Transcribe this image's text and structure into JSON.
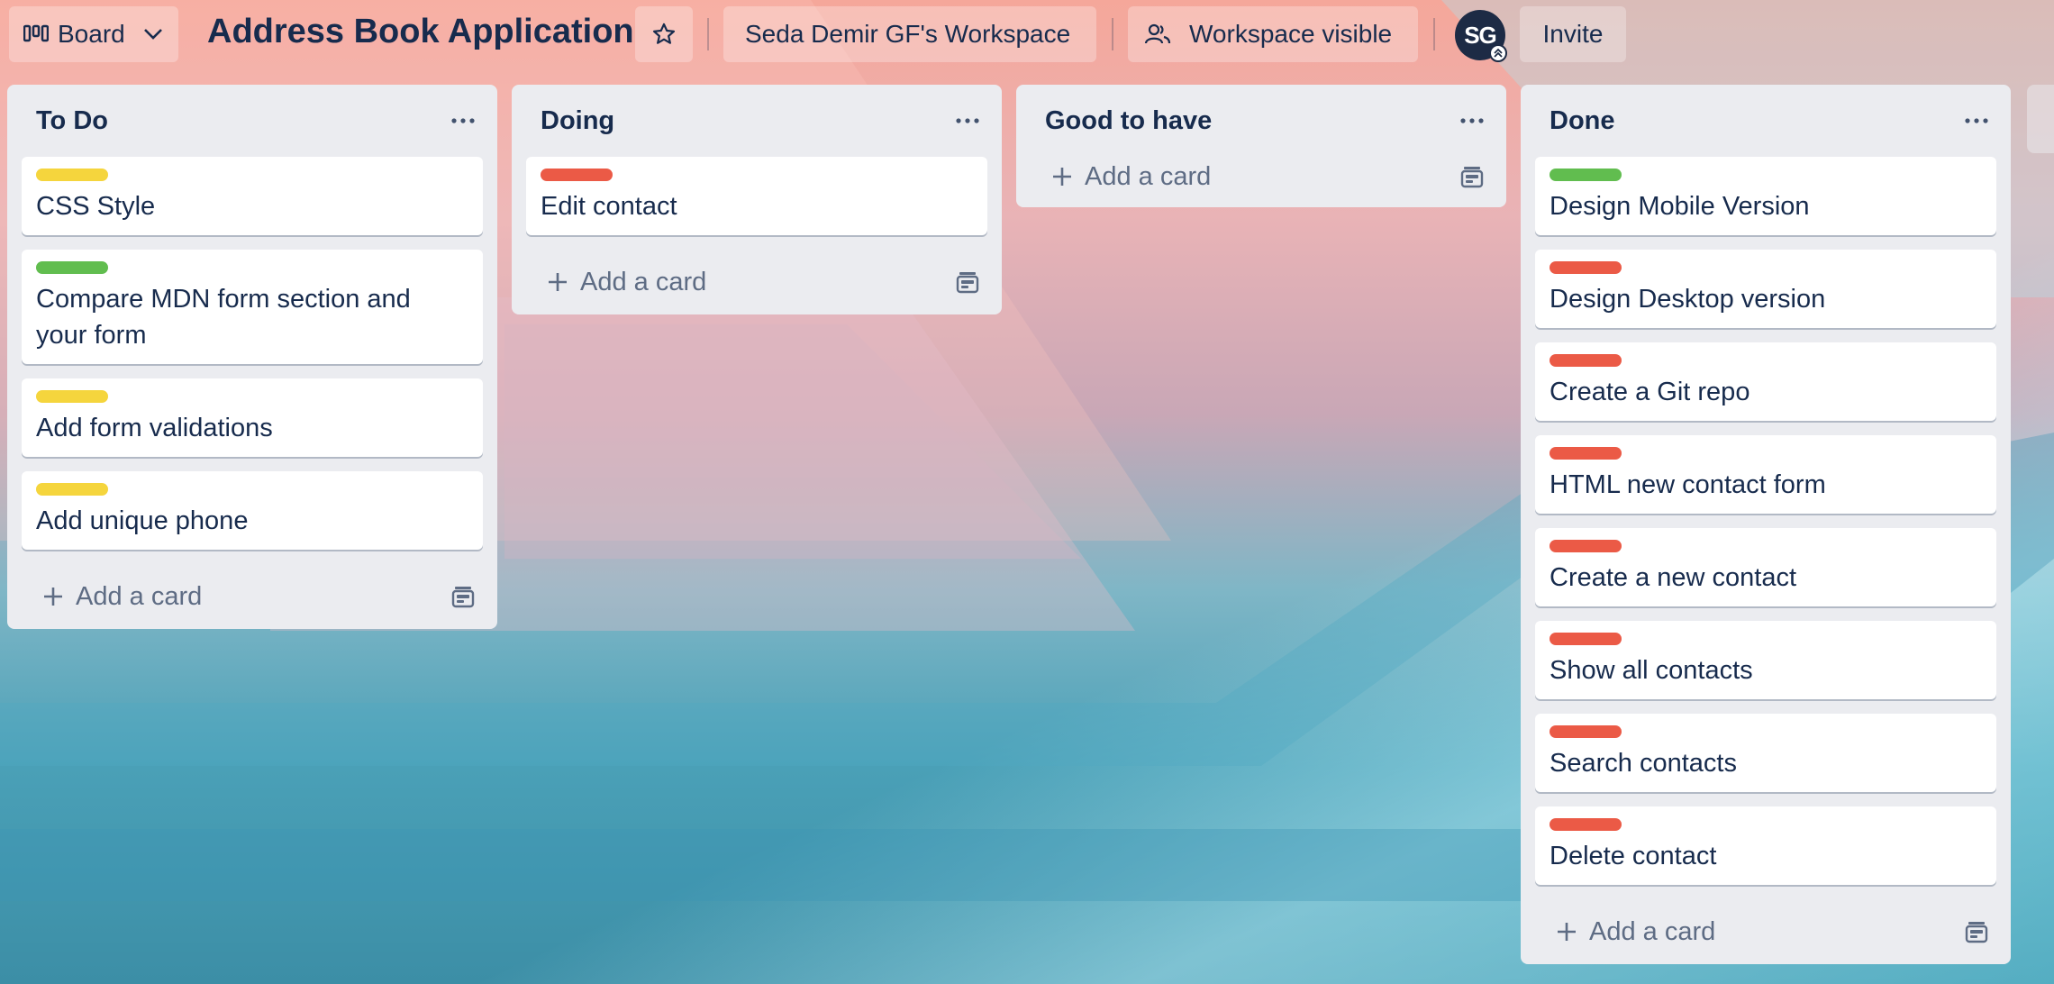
{
  "header": {
    "view_button": {
      "label": "Board",
      "icon": "board-icon"
    },
    "board_title": "Address Book Application",
    "star_icon": "star-icon",
    "workspace_button": {
      "label": "Seda Demir GF's Workspace"
    },
    "visibility_button": {
      "label": "Workspace visible",
      "icon": "people-icon"
    },
    "avatar": {
      "initials": "SG"
    },
    "invite_button": {
      "label": "Invite"
    }
  },
  "colors": {
    "yellow": "#f5d53d",
    "green": "#61bd4f",
    "red": "#eb5a46",
    "list_bg": "#ebecf0",
    "text": "#172b4d"
  },
  "lists": [
    {
      "title": "To Do",
      "cards": [
        {
          "label_color": "yellow",
          "title": "CSS Style"
        },
        {
          "label_color": "green",
          "title": "Compare MDN form section and your form"
        },
        {
          "label_color": "yellow",
          "title": "Add form validations"
        },
        {
          "label_color": "yellow",
          "title": "Add unique phone"
        }
      ],
      "add_label": "Add a card"
    },
    {
      "title": "Doing",
      "cards": [
        {
          "label_color": "red",
          "title": "Edit contact"
        }
      ],
      "add_label": "Add a card"
    },
    {
      "title": "Good to have",
      "cards": [],
      "add_label": "Add a card"
    },
    {
      "title": "Done",
      "cards": [
        {
          "label_color": "green",
          "title": "Design Mobile Version"
        },
        {
          "label_color": "red",
          "title": "Design Desktop version"
        },
        {
          "label_color": "red",
          "title": "Create a Git repo"
        },
        {
          "label_color": "red",
          "title": "HTML new contact form"
        },
        {
          "label_color": "red",
          "title": "Create a new contact"
        },
        {
          "label_color": "red",
          "title": "Show all contacts"
        },
        {
          "label_color": "red",
          "title": "Search contacts"
        },
        {
          "label_color": "red",
          "title": "Delete contact"
        }
      ],
      "add_label": "Add a card"
    }
  ]
}
